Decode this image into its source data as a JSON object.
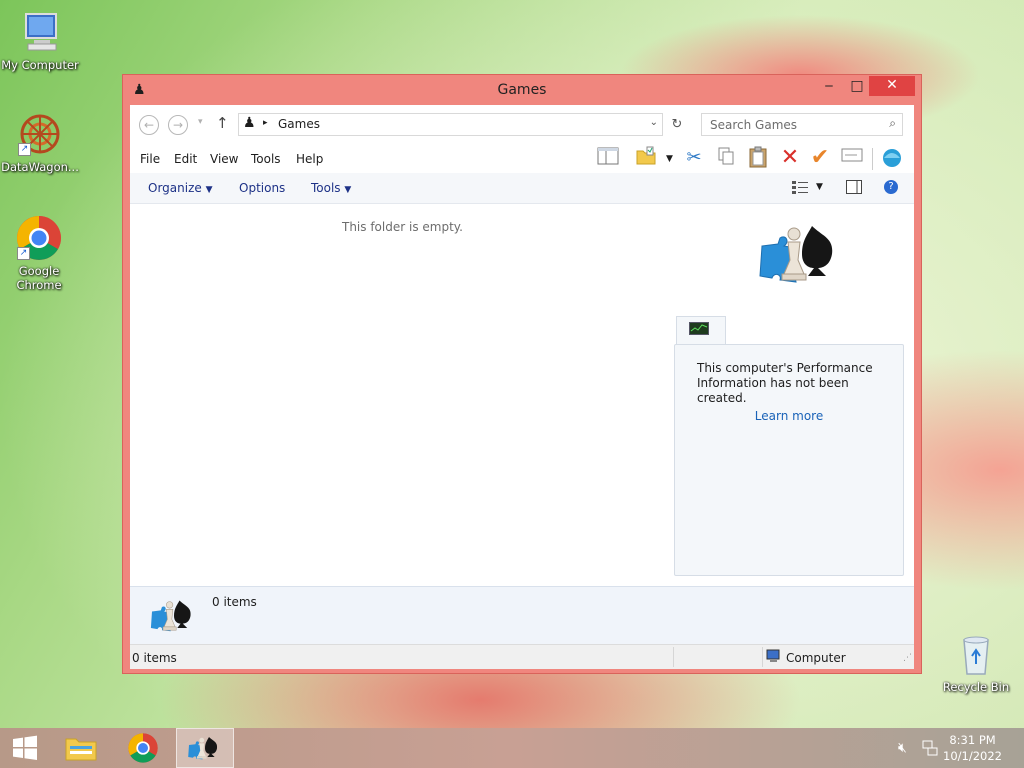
{
  "desktop": {
    "icons": [
      {
        "label": "My Computer"
      },
      {
        "label": "DataWagon..."
      },
      {
        "label": "Google Chrome"
      },
      {
        "label": "Recycle Bin"
      }
    ]
  },
  "window": {
    "title": "Games",
    "address": {
      "path": "Games"
    },
    "search": {
      "placeholder": "Search Games"
    },
    "menu": [
      "File",
      "Edit",
      "View",
      "Tools",
      "Help"
    ],
    "commands": {
      "organize": "Organize",
      "options": "Options",
      "tools": "Tools"
    },
    "content": {
      "empty_message": "This folder is empty."
    },
    "performance": {
      "message": "This computer's Performance Information has not been created.",
      "link": "Learn more"
    },
    "details": {
      "count": "0 items"
    },
    "status": {
      "left": "0 items",
      "right": "Computer"
    }
  },
  "taskbar": {
    "time": "8:31 PM",
    "date": "10/1/2022"
  },
  "colors": {
    "title_bar": "#f0867e",
    "close_button": "#e04343",
    "link": "#1a63b8",
    "command_text": "#1e3287"
  }
}
